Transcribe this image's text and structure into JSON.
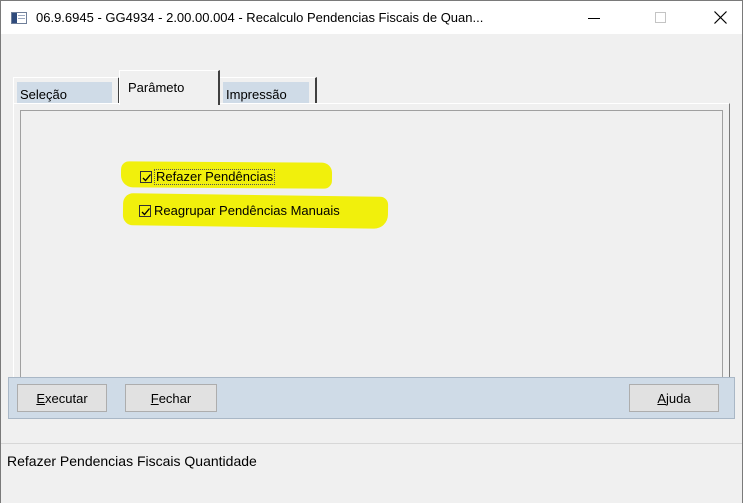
{
  "window": {
    "title": "06.9.6945 - GG4934 - 2.00.00.004 - Recalculo Pendencias Fiscais de Quan...",
    "minimize_glyph": "—",
    "maximize_glyph": "☐",
    "close_glyph": "✕"
  },
  "tabs": [
    {
      "label": "Seleção",
      "selected": false
    },
    {
      "label": "Parâmeto",
      "selected": true
    },
    {
      "label": "Impressão",
      "selected": false
    }
  ],
  "options": [
    {
      "label": "Refazer Pendências",
      "checked": true,
      "highlighted": true
    },
    {
      "label": "Reagrupar Pendências Manuais",
      "checked": true,
      "highlighted": true
    }
  ],
  "buttons": {
    "executar": {
      "mnemonic": "E",
      "rest": "xecutar"
    },
    "fechar": {
      "mnemonic": "F",
      "rest": "echar"
    },
    "ajuda": {
      "mnemonic": "A",
      "rest": "juda"
    }
  },
  "status": {
    "text": "Refazer Pendencias Fiscais Quantidade"
  },
  "colors": {
    "highlight": "#f1f00c",
    "tab_fill": "#cfdbe7",
    "button_bar": "#cfdbe7",
    "window_bg": "#f0f0f0"
  },
  "icons": [
    "app-icon",
    "minimize-icon",
    "maximize-icon",
    "close-icon",
    "checkmark-icon"
  ]
}
